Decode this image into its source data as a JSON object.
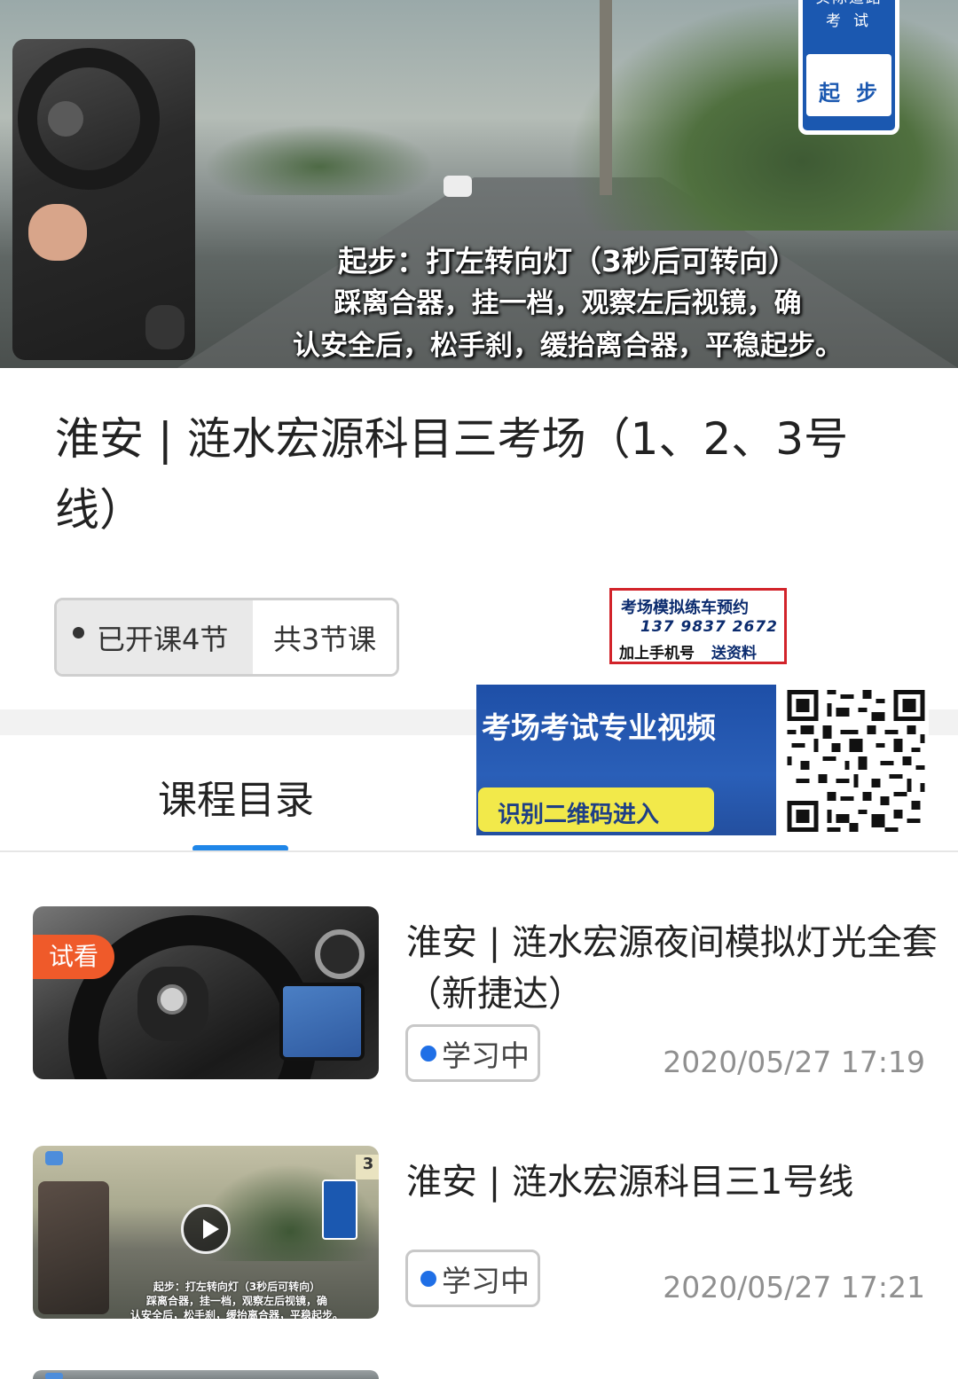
{
  "hero": {
    "sign_line1": "实际道路",
    "sign_line2": "考试",
    "sign_line3": "起步",
    "subtitle_line1": "起步：打左转向灯（3秒后可转向）",
    "subtitle_line2": "踩离合器，挂一档，观察左后视镜，确",
    "subtitle_line3": "认安全后，松手刹，缓抬离合器，平稳起步。"
  },
  "course": {
    "title": "淮安 | 涟水宏源科目三考场（1、2、3号线）",
    "opened_label": "已开课4节",
    "total_label": "共3节课"
  },
  "ads": {
    "booking_line1": "考场模拟练车预约",
    "booking_phone": "137 9837 2672",
    "booking_line3a": "加上手机号",
    "booking_line3b": "送资料",
    "video_headline": "考场考试专业视频",
    "video_button": "识别二维码进入"
  },
  "tabs": {
    "catalog": "课程目录",
    "accent_color": "#1f86e8"
  },
  "lessons": [
    {
      "badge": "试看",
      "title": "淮安 | 涟水宏源夜间模拟灯光全套（新捷达）",
      "status": "学习中",
      "date": "2020/05/27 17:19"
    },
    {
      "title": "淮安 | 涟水宏源科目三1号线",
      "status": "学习中",
      "date": "2020/05/27 17:21",
      "thumb_subtitle1": "起步：打左转向灯（3秒后可转向）",
      "thumb_subtitle2": "踩离合器，挂一档，观察左后视镜，确",
      "thumb_subtitle3": "认安全后，松手刹，缓抬离合器，平稳起步。",
      "thumb_sign1": "实际道路",
      "thumb_sign2": "考试",
      "thumb_sign3": "起步",
      "thumb_corner": "3"
    }
  ],
  "colors": {
    "trial_badge": "#ef5a2a",
    "status_dot": "#1f6fe6",
    "sign_blue": "#1b58b0"
  },
  "icons": {
    "play": "play-icon",
    "cloud": "cloud-icon"
  }
}
